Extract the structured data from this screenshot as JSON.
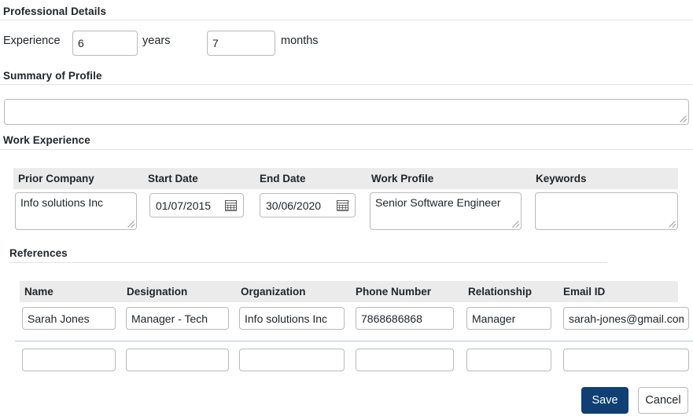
{
  "sections": {
    "professional_details": {
      "title": "Professional Details"
    },
    "summary_of_profile": {
      "title": "Summary of Profile"
    },
    "work_experience": {
      "title": "Work Experience"
    },
    "references": {
      "title": "References"
    }
  },
  "experience": {
    "label": "Experience",
    "years_value": "6",
    "years_unit": "years",
    "months_value": "7",
    "months_unit": "months"
  },
  "summary": {
    "value": "",
    "placeholder": ""
  },
  "work_experience_table": {
    "columns": [
      "Prior Company",
      "Start Date",
      "End Date",
      "Work Profile",
      "Keywords"
    ],
    "rows": [
      {
        "prior_company": "Info solutions Inc",
        "start_date": "01/07/2015",
        "end_date": "30/06/2020",
        "work_profile": "Senior Software Engineer",
        "keywords": ""
      }
    ],
    "calendar_icon": "calendar-icon"
  },
  "references_table": {
    "columns": [
      "Name",
      "Designation",
      "Organization",
      "Phone Number",
      "Relationship",
      "Email ID"
    ],
    "rows": [
      {
        "name": "Sarah Jones",
        "designation": "Manager - Tech",
        "organization": "Info solutions Inc",
        "phone_number": "7868686868",
        "relationship": "Manager",
        "email_id": "sarah-jones@gmail.com"
      },
      {
        "name": "",
        "designation": "",
        "organization": "",
        "phone_number": "",
        "relationship": "",
        "email_id": ""
      }
    ]
  },
  "actions": {
    "save_label": "Save",
    "cancel_label": "Cancel"
  },
  "colors": {
    "primary": "#0f3f73",
    "header_band": "#ebebeb",
    "divider": "#e3e3e3",
    "input_border": "#b9b9b9",
    "text": "#212529"
  }
}
